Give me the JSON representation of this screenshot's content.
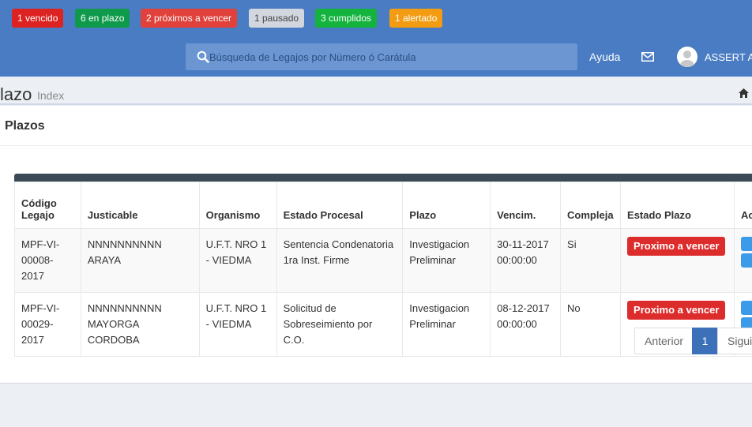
{
  "badges": [
    {
      "label": "1 vencido",
      "color": "#dd2222"
    },
    {
      "label": "6 en plazo",
      "color": "#0e9a4a"
    },
    {
      "label": "2 próximos a vencer",
      "color": "#e0413a"
    },
    {
      "label": "1 pausado",
      "color": "#d2d6de"
    },
    {
      "label": "3 cumplidos",
      "color": "#13b33e"
    },
    {
      "label": "1 alertado",
      "color": "#f39c12"
    }
  ],
  "search": {
    "placeholder": "Búsqueda de Legajos por Número ó Carátula",
    "icon": "search-icon"
  },
  "nav": {
    "help": "Ayuda",
    "mail_icon": "envelope-icon",
    "user": "ASSERT AS"
  },
  "header": {
    "title": "lazo",
    "subtitle": "Index",
    "home_icon": "home-icon"
  },
  "box": {
    "title": "Plazos"
  },
  "table": {
    "columns": [
      "Código Legajo",
      "Justicable",
      "Organismo",
      "Estado Procesal",
      "Plazo",
      "Vencim.",
      "Compleja",
      "Estado Plazo",
      "Ac"
    ],
    "rows": [
      {
        "legajo": "MPF-VI-00008-2017",
        "justicable": "NNNNNNNNNN ARAYA",
        "organismo": "U.F.T. NRO 1 - VIEDMA",
        "estado_procesal": "Sentencia Condenatoria 1ra Inst. Firme",
        "plazo": "Investigacion Preliminar",
        "vencim": "30-11-2017 00:00:00",
        "compleja": "Si",
        "estado_plazo": "Proximo a vencer"
      },
      {
        "legajo": "MPF-VI-00029-2017",
        "justicable": "NNNNNNNNNN MAYORGA CORDOBA",
        "organismo": "U.F.T. NRO 1 - VIEDMA",
        "estado_procesal": "Solicitud de Sobreseimiento por C.O.",
        "plazo": "Investigacion Preliminar",
        "vencim": "08-12-2017 00:00:00",
        "compleja": "No",
        "estado_plazo": "Proximo a vencer"
      }
    ]
  },
  "pagination": {
    "prev": "Anterior",
    "current": "1",
    "next": "Siguiente"
  }
}
